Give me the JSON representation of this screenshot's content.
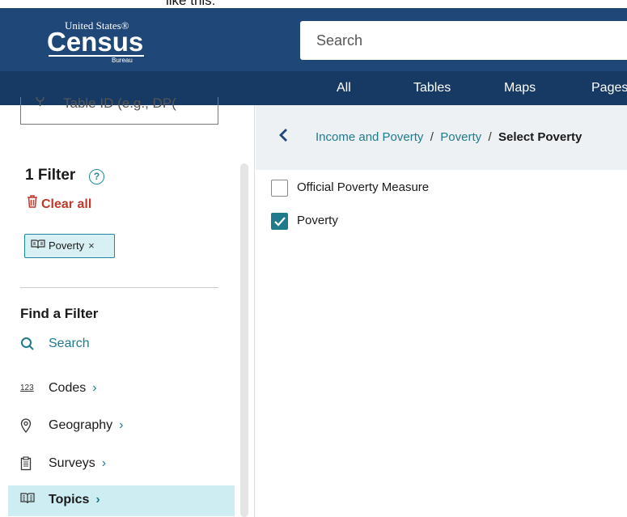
{
  "top_strip_text": "like this:",
  "header": {
    "logo": {
      "line1": "United States®",
      "line2": "Census",
      "line3": "Bureau"
    },
    "search_placeholder": "Search"
  },
  "tabs": [
    "All",
    "Tables",
    "Maps",
    "Pages"
  ],
  "sidebar": {
    "table_search_placeholder": "Table ID (e.g., DP(",
    "filter_count_title": "1 Filter",
    "help_icon": "?",
    "clear_all": "Clear all",
    "chip": {
      "label": "Poverty",
      "close": "×"
    },
    "find_title": "Find a Filter",
    "nav": [
      {
        "icon": "search-icon",
        "glyph": "⚲",
        "label": "Search",
        "chevron": ""
      },
      {
        "icon": "codes-icon",
        "glyph": "123",
        "label": "Codes",
        "chevron": "›"
      },
      {
        "icon": "location-pin-icon",
        "glyph": "◎",
        "label": "Geography",
        "chevron": "›"
      },
      {
        "icon": "clipboard-icon",
        "glyph": "▤",
        "label": "Surveys",
        "chevron": "›"
      },
      {
        "icon": "book-icon",
        "glyph": "▥",
        "label": "Topics",
        "chevron": "›"
      }
    ]
  },
  "main": {
    "breadcrumbs": [
      "Income and Poverty",
      "Poverty"
    ],
    "current_crumb": "Select Poverty",
    "separator": "/",
    "options": [
      {
        "label": "Official Poverty Measure",
        "checked": false
      },
      {
        "label": "Poverty",
        "checked": true
      }
    ]
  },
  "colors": {
    "header_bg": "#1f4778",
    "tabbar_bg": "#173a64",
    "accent_teal": "#1f7b8c",
    "clear_all_red": "#c0392b",
    "active_bg": "#cdedf2"
  }
}
